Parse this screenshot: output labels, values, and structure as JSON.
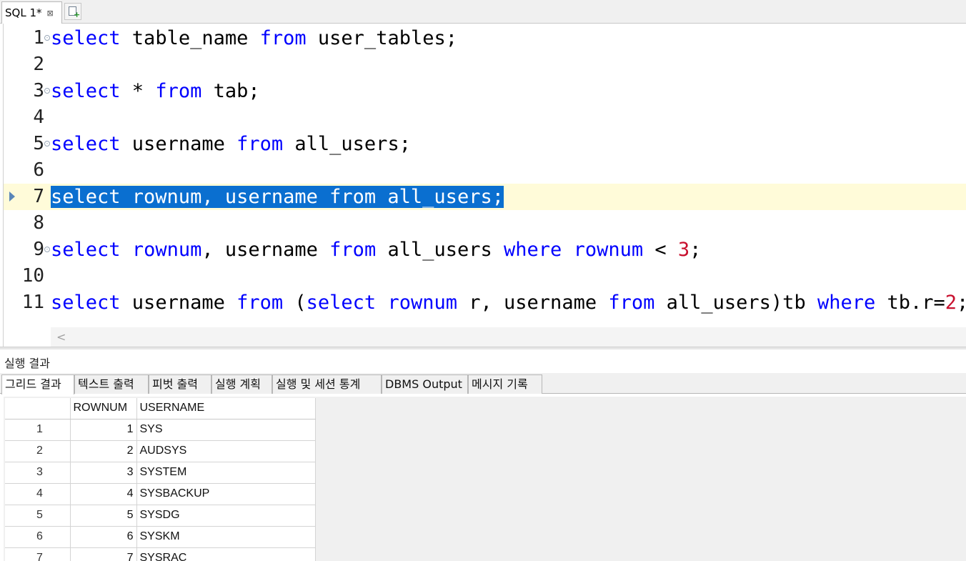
{
  "editor_tab": {
    "label": "SQL 1*",
    "close_glyph": "⊠"
  },
  "editor_lines": [
    {
      "num": "1"
    },
    {
      "num": "2"
    },
    {
      "num": "3"
    },
    {
      "num": "4"
    },
    {
      "num": "5"
    },
    {
      "num": "6"
    },
    {
      "num": "7"
    },
    {
      "num": "8"
    },
    {
      "num": "9"
    },
    {
      "num": "10"
    },
    {
      "num": "11"
    }
  ],
  "code": {
    "l1": [
      "select",
      " table_name ",
      "from",
      " user_tables;"
    ],
    "l3": [
      "select",
      " * ",
      "from",
      " tab;"
    ],
    "l5": [
      "select",
      " username ",
      "from",
      " all_users;"
    ],
    "l7": "select rownum, username from all_users;",
    "l9": [
      "select",
      " ",
      "rownum",
      ", username ",
      "from",
      " all_users ",
      "where",
      " ",
      "rownum",
      " < ",
      "3",
      ";"
    ],
    "l11": [
      "select",
      " username ",
      "from",
      " (",
      "select",
      " ",
      "rownum",
      " r, username ",
      "from",
      " all_users)tb ",
      "where",
      " tb.r=",
      "2",
      ";"
    ]
  },
  "hscroll": {
    "left_arrow": "<"
  },
  "results": {
    "title": "실행 결과",
    "tabs": [
      "그리드 결과",
      "텍스트 출력",
      "피벗 출력",
      "실행 계획",
      "실행 및 세션 통계",
      "DBMS Output",
      "메시지 기록"
    ],
    "columns": [
      "ROWNUM",
      "USERNAME"
    ],
    "rows": [
      {
        "no": "1",
        "rownum": "1",
        "username": "SYS"
      },
      {
        "no": "2",
        "rownum": "2",
        "username": "AUDSYS"
      },
      {
        "no": "3",
        "rownum": "3",
        "username": "SYSTEM"
      },
      {
        "no": "4",
        "rownum": "4",
        "username": "SYSBACKUP"
      },
      {
        "no": "5",
        "rownum": "5",
        "username": "SYSDG"
      },
      {
        "no": "6",
        "rownum": "6",
        "username": "SYSKM"
      },
      {
        "no": "7",
        "rownum": "7",
        "username": "SYSRAC"
      }
    ]
  },
  "colors": {
    "keyword": "#0000ff",
    "number": "#c8102e",
    "selection": "#0a6fd0",
    "current_line": "#fffbd9"
  }
}
